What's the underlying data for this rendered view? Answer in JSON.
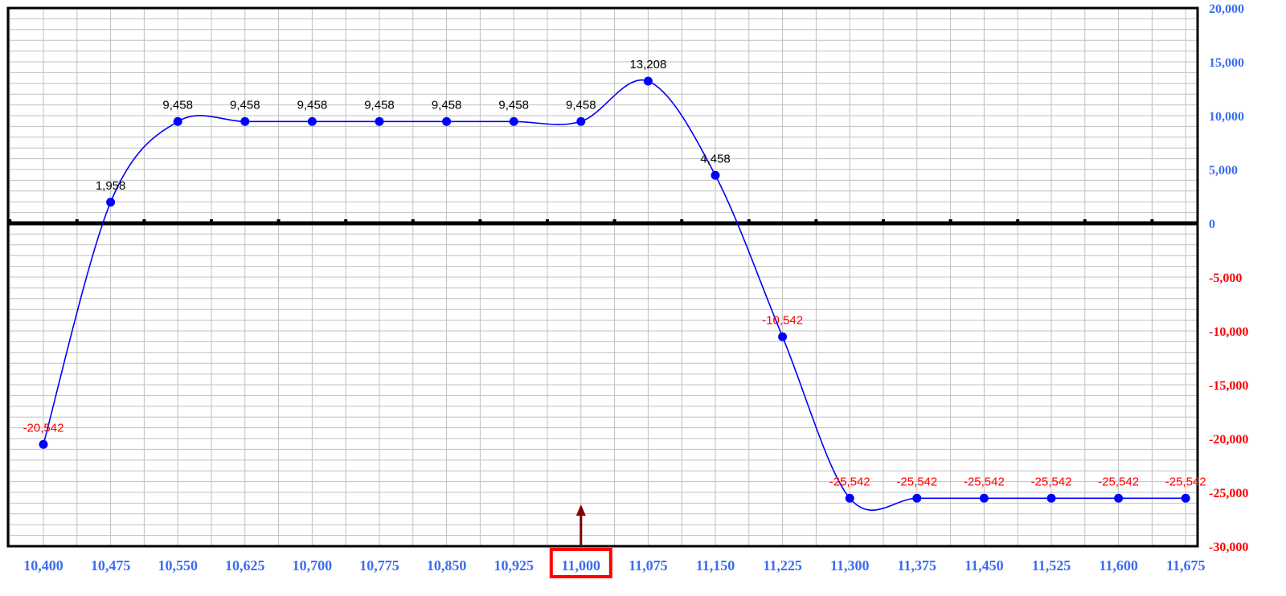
{
  "chart_data": {
    "type": "line",
    "title": "",
    "xlabel": "",
    "ylabel": "",
    "x": [
      "10,400",
      "10,475",
      "10,550",
      "10,625",
      "10,700",
      "10,775",
      "10,850",
      "10,925",
      "11,000",
      "11,075",
      "11,150",
      "11,225",
      "11,300",
      "11,375",
      "11,450",
      "11,525",
      "11,600",
      "11,675"
    ],
    "values": [
      -20542,
      1958,
      9458,
      9458,
      9458,
      9458,
      9458,
      9458,
      9458,
      13208,
      4458,
      -10542,
      -25542,
      -25542,
      -25542,
      -25542,
      -25542,
      -25542
    ],
    "data_labels": [
      "-20,542",
      "1,958",
      "9,458",
      "9,458",
      "9,458",
      "9,458",
      "9,458",
      "9,458",
      "9,458",
      "13,208",
      "4,458",
      "-10,542",
      "-25,542",
      "-25,542",
      "-25,542",
      "-25,542",
      "-25,542",
      "-25,542"
    ],
    "ylim": [
      -30000,
      20000
    ],
    "yticks": [
      20000,
      15000,
      10000,
      5000,
      0,
      -5000,
      -10000,
      -15000,
      -20000,
      -25000,
      -30000
    ],
    "ytick_labels": [
      "20,000",
      "15,000",
      "10,000",
      "5,000",
      "0",
      "-5,000",
      "-10,000",
      "-15,000",
      "-20,000",
      "-25,000",
      "-30,000"
    ],
    "y_axis_side": "right",
    "grid": true,
    "smooth": true,
    "highlighted_x": "11,000",
    "colors": {
      "line": "#0000ff",
      "marker": "#0000ff",
      "positive_label": "#000000",
      "negative_label": "#ff0000",
      "positive_tick": "#3b6df0",
      "negative_tick": "#ff0000",
      "x_tick": "#3b6df0",
      "highlight_box": "#ff0000",
      "arrow": "#800000",
      "grid": "#c0c0c0",
      "axis": "#000000"
    }
  }
}
